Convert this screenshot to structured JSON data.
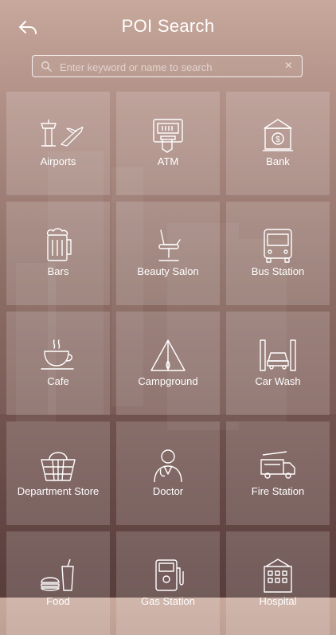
{
  "header": {
    "title": "POI Search"
  },
  "search": {
    "placeholder": "Enter keyword or name to search",
    "value": ""
  },
  "categories": [
    {
      "label": "Airports",
      "icon": "airport-icon"
    },
    {
      "label": "ATM",
      "icon": "atm-icon"
    },
    {
      "label": "Bank",
      "icon": "bank-icon"
    },
    {
      "label": "Bars",
      "icon": "beer-mug-icon"
    },
    {
      "label": "Beauty Salon",
      "icon": "salon-chair-icon"
    },
    {
      "label": "Bus Station",
      "icon": "bus-icon"
    },
    {
      "label": "Cafe",
      "icon": "coffee-cup-icon"
    },
    {
      "label": "Campground",
      "icon": "tent-icon"
    },
    {
      "label": "Car Wash",
      "icon": "car-wash-icon"
    },
    {
      "label": "Department Store",
      "icon": "basket-icon"
    },
    {
      "label": "Doctor",
      "icon": "doctor-icon"
    },
    {
      "label": "Fire Station",
      "icon": "fire-truck-icon"
    },
    {
      "label": "Food",
      "icon": "burger-drink-icon"
    },
    {
      "label": "Gas Station",
      "icon": "fuel-pump-icon"
    },
    {
      "label": "Hospital",
      "icon": "hospital-building-icon"
    }
  ]
}
